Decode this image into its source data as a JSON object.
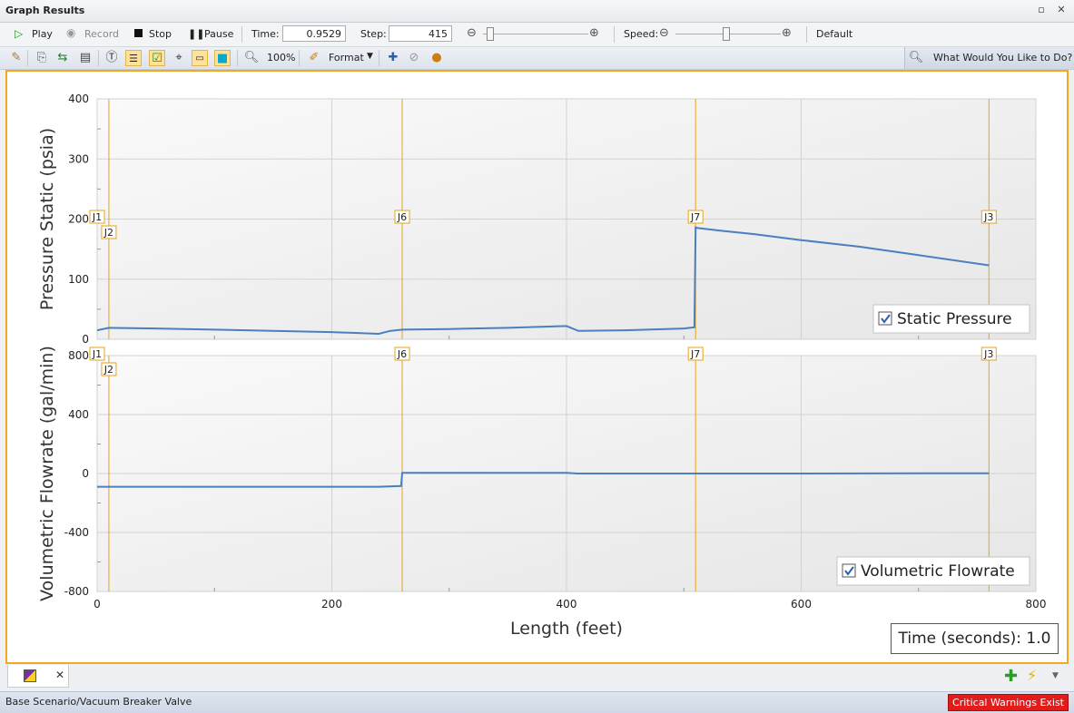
{
  "window": {
    "title": "Graph Results"
  },
  "toolbar": {
    "play": "Play",
    "record": "Record",
    "stop": "Stop",
    "pause": "Pause",
    "time_label": "Time:",
    "time_value": "0.9529",
    "step_label": "Step:",
    "step_value": "415",
    "speed_label": "Speed:",
    "speed_default": "Default",
    "zoom": "100%",
    "format": "Format",
    "help": "What Would You Like to Do?"
  },
  "chart_data": [
    {
      "type": "line",
      "ylabel": "Pressure Static (psia)",
      "xlabel": "",
      "xlim": [
        0,
        800
      ],
      "ylim": [
        0,
        400
      ],
      "xticks": [
        "0",
        "200",
        "400",
        "600",
        "800"
      ],
      "yticks": [
        "0",
        "100",
        "200",
        "300",
        "400"
      ],
      "legend": "Static Pressure",
      "legend_position": "bottom-right",
      "markers": [
        {
          "label": "J1",
          "x": 0
        },
        {
          "label": "J2",
          "x": 10
        },
        {
          "label": "J6",
          "x": 260
        },
        {
          "label": "J7",
          "x": 510
        },
        {
          "label": "J3",
          "x": 760
        }
      ],
      "series": [
        {
          "color": "#4a7fc1",
          "x": [
            0,
            10,
            50,
            100,
            150,
            200,
            240,
            250,
            260,
            300,
            350,
            400,
            410,
            450,
            500,
            509,
            510,
            512,
            530,
            560,
            600,
            650,
            700,
            760
          ],
          "y": [
            15,
            19,
            18,
            16,
            14,
            12,
            9,
            14,
            16,
            17,
            19,
            22,
            14,
            15,
            18,
            20,
            186,
            185,
            181,
            175,
            165,
            154,
            140,
            123
          ]
        }
      ]
    },
    {
      "type": "line",
      "ylabel": "Volumetric Flowrate (gal/min)",
      "xlabel": "Length (feet)",
      "xlim": [
        0,
        800
      ],
      "ylim": [
        -800,
        800
      ],
      "xticks": [
        "0",
        "200",
        "400",
        "600",
        "800"
      ],
      "yticks": [
        "-800",
        "-400",
        "0",
        "400",
        "800"
      ],
      "legend": "Volumetric Flowrate",
      "legend_position": "bottom-right",
      "markers": [
        {
          "label": "J1",
          "x": 0
        },
        {
          "label": "J2",
          "x": 10
        },
        {
          "label": "J6",
          "x": 260
        },
        {
          "label": "J7",
          "x": 510
        },
        {
          "label": "J3",
          "x": 760
        }
      ],
      "series": [
        {
          "color": "#4a7fc1",
          "x": [
            0,
            100,
            200,
            240,
            259,
            260,
            400,
            410,
            600,
            760
          ],
          "y": [
            -90,
            -90,
            -90,
            -90,
            -85,
            5,
            5,
            0,
            0,
            2
          ]
        }
      ]
    }
  ],
  "time_readout": "Time (seconds): 1.0",
  "status": {
    "scenario": "Base Scenario/Vacuum Breaker Valve",
    "warning": "Critical Warnings Exist"
  },
  "colors": {
    "accent": "#f5a623",
    "line": "#4a7fc1",
    "marker": "#e8a317",
    "warning": "#e21b1b"
  }
}
